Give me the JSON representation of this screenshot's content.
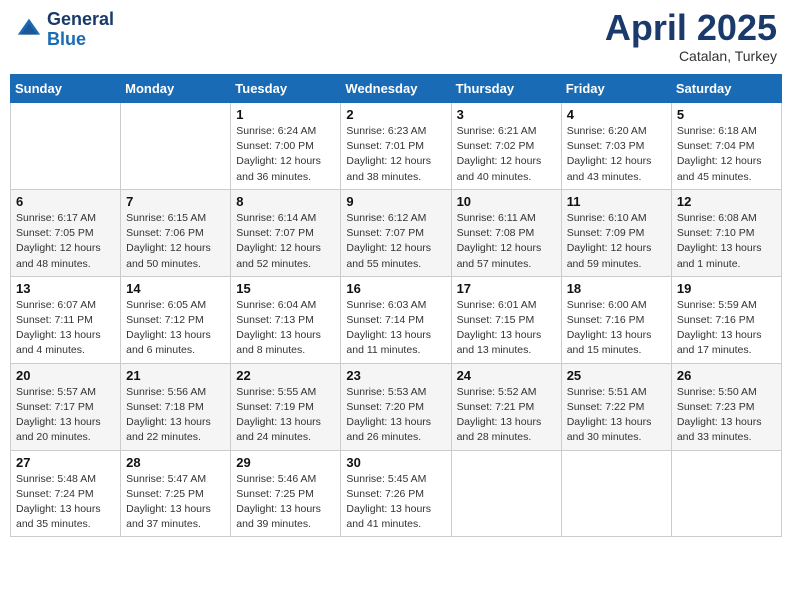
{
  "header": {
    "logo_line1": "General",
    "logo_line2": "Blue",
    "month": "April 2025",
    "location": "Catalan, Turkey"
  },
  "days_of_week": [
    "Sunday",
    "Monday",
    "Tuesday",
    "Wednesday",
    "Thursday",
    "Friday",
    "Saturday"
  ],
  "weeks": [
    [
      {
        "num": "",
        "info": ""
      },
      {
        "num": "",
        "info": ""
      },
      {
        "num": "1",
        "info": "Sunrise: 6:24 AM\nSunset: 7:00 PM\nDaylight: 12 hours and 36 minutes."
      },
      {
        "num": "2",
        "info": "Sunrise: 6:23 AM\nSunset: 7:01 PM\nDaylight: 12 hours and 38 minutes."
      },
      {
        "num": "3",
        "info": "Sunrise: 6:21 AM\nSunset: 7:02 PM\nDaylight: 12 hours and 40 minutes."
      },
      {
        "num": "4",
        "info": "Sunrise: 6:20 AM\nSunset: 7:03 PM\nDaylight: 12 hours and 43 minutes."
      },
      {
        "num": "5",
        "info": "Sunrise: 6:18 AM\nSunset: 7:04 PM\nDaylight: 12 hours and 45 minutes."
      }
    ],
    [
      {
        "num": "6",
        "info": "Sunrise: 6:17 AM\nSunset: 7:05 PM\nDaylight: 12 hours and 48 minutes."
      },
      {
        "num": "7",
        "info": "Sunrise: 6:15 AM\nSunset: 7:06 PM\nDaylight: 12 hours and 50 minutes."
      },
      {
        "num": "8",
        "info": "Sunrise: 6:14 AM\nSunset: 7:07 PM\nDaylight: 12 hours and 52 minutes."
      },
      {
        "num": "9",
        "info": "Sunrise: 6:12 AM\nSunset: 7:07 PM\nDaylight: 12 hours and 55 minutes."
      },
      {
        "num": "10",
        "info": "Sunrise: 6:11 AM\nSunset: 7:08 PM\nDaylight: 12 hours and 57 minutes."
      },
      {
        "num": "11",
        "info": "Sunrise: 6:10 AM\nSunset: 7:09 PM\nDaylight: 12 hours and 59 minutes."
      },
      {
        "num": "12",
        "info": "Sunrise: 6:08 AM\nSunset: 7:10 PM\nDaylight: 13 hours and 1 minute."
      }
    ],
    [
      {
        "num": "13",
        "info": "Sunrise: 6:07 AM\nSunset: 7:11 PM\nDaylight: 13 hours and 4 minutes."
      },
      {
        "num": "14",
        "info": "Sunrise: 6:05 AM\nSunset: 7:12 PM\nDaylight: 13 hours and 6 minutes."
      },
      {
        "num": "15",
        "info": "Sunrise: 6:04 AM\nSunset: 7:13 PM\nDaylight: 13 hours and 8 minutes."
      },
      {
        "num": "16",
        "info": "Sunrise: 6:03 AM\nSunset: 7:14 PM\nDaylight: 13 hours and 11 minutes."
      },
      {
        "num": "17",
        "info": "Sunrise: 6:01 AM\nSunset: 7:15 PM\nDaylight: 13 hours and 13 minutes."
      },
      {
        "num": "18",
        "info": "Sunrise: 6:00 AM\nSunset: 7:16 PM\nDaylight: 13 hours and 15 minutes."
      },
      {
        "num": "19",
        "info": "Sunrise: 5:59 AM\nSunset: 7:16 PM\nDaylight: 13 hours and 17 minutes."
      }
    ],
    [
      {
        "num": "20",
        "info": "Sunrise: 5:57 AM\nSunset: 7:17 PM\nDaylight: 13 hours and 20 minutes."
      },
      {
        "num": "21",
        "info": "Sunrise: 5:56 AM\nSunset: 7:18 PM\nDaylight: 13 hours and 22 minutes."
      },
      {
        "num": "22",
        "info": "Sunrise: 5:55 AM\nSunset: 7:19 PM\nDaylight: 13 hours and 24 minutes."
      },
      {
        "num": "23",
        "info": "Sunrise: 5:53 AM\nSunset: 7:20 PM\nDaylight: 13 hours and 26 minutes."
      },
      {
        "num": "24",
        "info": "Sunrise: 5:52 AM\nSunset: 7:21 PM\nDaylight: 13 hours and 28 minutes."
      },
      {
        "num": "25",
        "info": "Sunrise: 5:51 AM\nSunset: 7:22 PM\nDaylight: 13 hours and 30 minutes."
      },
      {
        "num": "26",
        "info": "Sunrise: 5:50 AM\nSunset: 7:23 PM\nDaylight: 13 hours and 33 minutes."
      }
    ],
    [
      {
        "num": "27",
        "info": "Sunrise: 5:48 AM\nSunset: 7:24 PM\nDaylight: 13 hours and 35 minutes."
      },
      {
        "num": "28",
        "info": "Sunrise: 5:47 AM\nSunset: 7:25 PM\nDaylight: 13 hours and 37 minutes."
      },
      {
        "num": "29",
        "info": "Sunrise: 5:46 AM\nSunset: 7:25 PM\nDaylight: 13 hours and 39 minutes."
      },
      {
        "num": "30",
        "info": "Sunrise: 5:45 AM\nSunset: 7:26 PM\nDaylight: 13 hours and 41 minutes."
      },
      {
        "num": "",
        "info": ""
      },
      {
        "num": "",
        "info": ""
      },
      {
        "num": "",
        "info": ""
      }
    ]
  ]
}
